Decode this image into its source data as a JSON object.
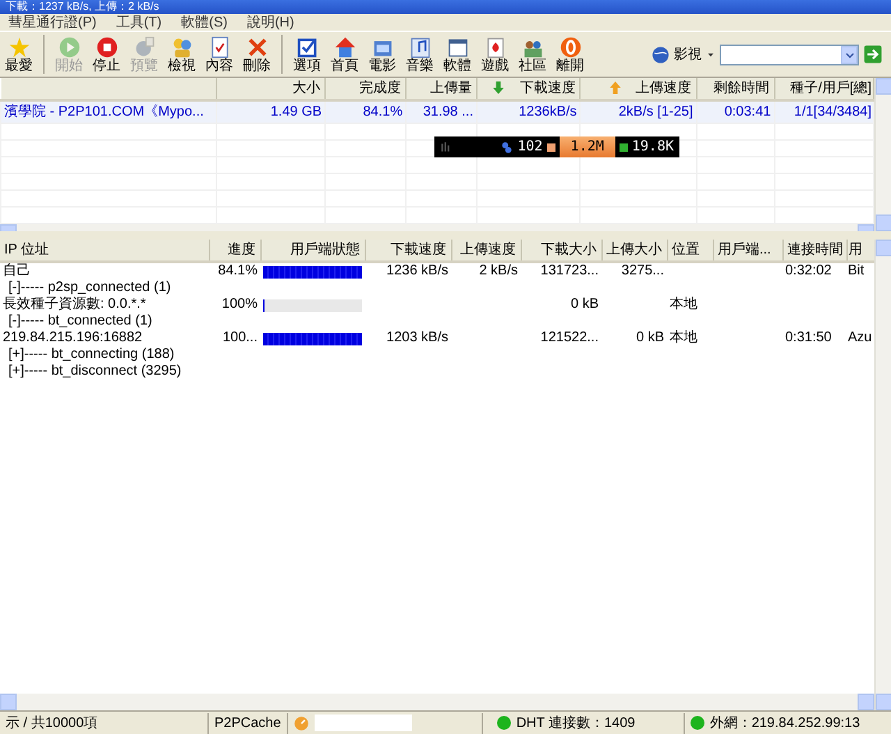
{
  "window": {
    "title": "下載：1237 kB/s, 上傳：2 kB/s"
  },
  "menu": [
    "彗星通行證(P)",
    "工具(T)",
    "軟體(S)",
    "說明(H)"
  ],
  "toolbar": [
    {
      "label": "最愛",
      "disabled": false
    },
    {
      "label": "開始",
      "disabled": true
    },
    {
      "label": "停止",
      "disabled": false
    },
    {
      "label": "預覽",
      "disabled": true
    },
    {
      "label": "檢視",
      "disabled": false
    },
    {
      "label": "內容",
      "disabled": false
    },
    {
      "label": "刪除",
      "disabled": false
    },
    {
      "label": "選項",
      "disabled": false
    },
    {
      "label": "首頁",
      "disabled": false
    },
    {
      "label": "電影",
      "disabled": false
    },
    {
      "label": "音樂",
      "disabled": false
    },
    {
      "label": "軟體",
      "disabled": false
    },
    {
      "label": "遊戲",
      "disabled": false
    },
    {
      "label": "社區",
      "disabled": false
    },
    {
      "label": "離開",
      "disabled": false
    }
  ],
  "search": {
    "category": "影視"
  },
  "tasks": {
    "columns": [
      "",
      "大小",
      "完成度",
      "上傳量",
      "下載速度",
      "上傳速度",
      "剩餘時間",
      "種子/用戶[總]"
    ],
    "rows": [
      {
        "cells": [
          "濱學院 - P2P101.COM《Mypo...",
          "1.49 GB",
          "84.1%",
          "31.98 ...",
          "1236kB/s",
          "2kB/s [1-25]",
          "0:03:41",
          "1/1[34/3484]"
        ]
      }
    ]
  },
  "speed_meter": {
    "count": "102",
    "download": "1.2M",
    "upload": "19.8K"
  },
  "peers": {
    "columns": [
      "IP 位址",
      "進度",
      "用戶端狀態",
      "下載速度",
      "上傳速度",
      "下載大小",
      "上傳大小",
      "位置",
      "用戶端...",
      "連接時間",
      "用"
    ],
    "rows": [
      {
        "kind": "peer",
        "cells": [
          "自己",
          "84.1%",
          "",
          "1236 kB/s",
          "2 kB/s",
          "131723...",
          "3275...",
          "",
          "",
          "0:32:02",
          "Bit"
        ],
        "level": 1
      },
      {
        "kind": "group",
        "label": "[-]----- p2sp_connected (1)",
        "children": [
          {
            "kind": "peer",
            "cells": [
              "長效種子資源數: 0.0.*.*",
              "100%",
              "",
              "",
              "",
              "0 kB",
              "",
              "本地",
              "",
              "",
              ""
            ],
            "level": 0.01
          }
        ]
      },
      {
        "kind": "group",
        "label": "[-]----- bt_connected (1)",
        "children": [
          {
            "kind": "peer",
            "cells": [
              "219.84.215.196:16882",
              "100...",
              "",
              "1203 kB/s",
              "",
              "121522...",
              "0 kB",
              "本地",
              "",
              "0:31:50",
              "Azu"
            ],
            "level": 1
          }
        ]
      },
      {
        "kind": "group",
        "label": "[+]----- bt_connecting (188)"
      },
      {
        "kind": "group",
        "label": "[+]----- bt_disconnect (3295)"
      }
    ]
  },
  "status_bar": {
    "items": "示 / 共10000項",
    "cache": "P2PCache",
    "dht": "DHT 連接數：1409",
    "external": "外網：219.84.252.99:13"
  }
}
